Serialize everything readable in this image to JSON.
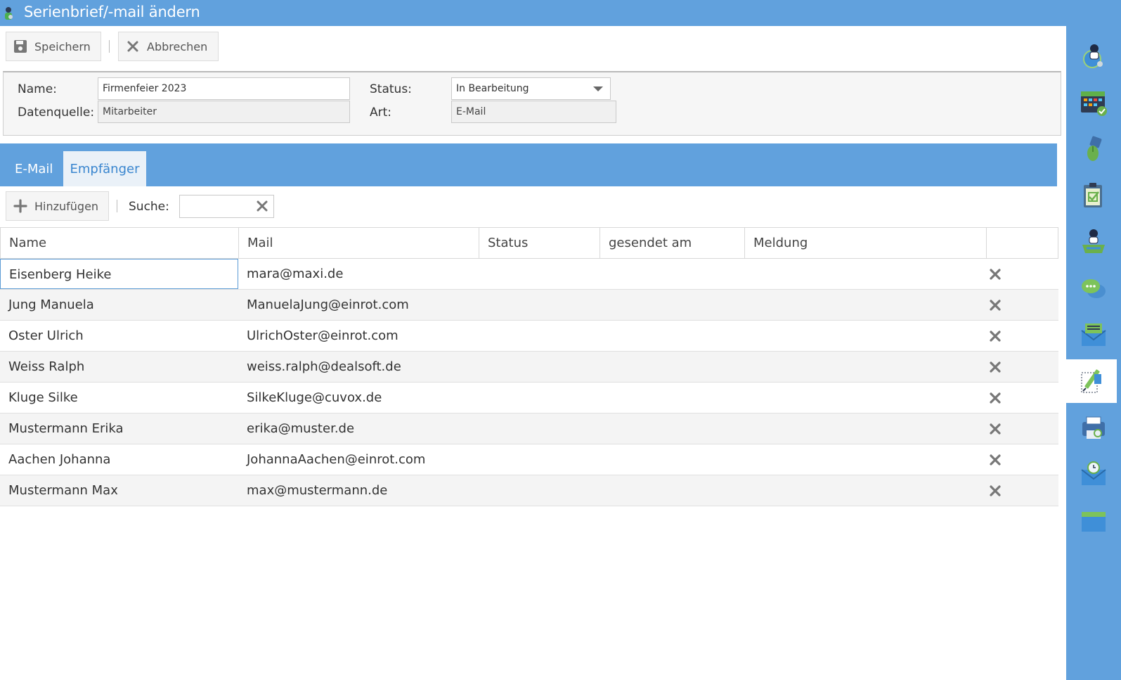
{
  "window": {
    "title": "Serienbrief/-mail ändern"
  },
  "toolbar": {
    "save_label": "Speichern",
    "cancel_label": "Abbrechen"
  },
  "form": {
    "name_label": "Name:",
    "name_value": "Firmenfeier 2023",
    "datasource_label": "Datenquelle:",
    "datasource_value": "Mitarbeiter",
    "status_label": "Status:",
    "status_value": "In Bearbeitung",
    "type_label": "Art:",
    "type_value": "E-Mail"
  },
  "tabs": [
    {
      "label": "E-Mail",
      "active": false
    },
    {
      "label": "Empfänger",
      "active": true
    }
  ],
  "recipients_toolbar": {
    "add_label": "Hinzufügen",
    "search_label": "Suche:",
    "search_value": ""
  },
  "grid": {
    "columns": [
      "Name",
      "Mail",
      "Status",
      "gesendet am",
      "Meldung",
      ""
    ],
    "rows": [
      {
        "name": "Eisenberg Heike",
        "mail": "mara@maxi.de",
        "status": "",
        "sent": "",
        "message": ""
      },
      {
        "name": "Jung Manuela",
        "mail": "ManuelaJung@einrot.com",
        "status": "",
        "sent": "",
        "message": ""
      },
      {
        "name": "Oster Ulrich",
        "mail": "UlrichOster@einrot.com",
        "status": "",
        "sent": "",
        "message": ""
      },
      {
        "name": "Weiss Ralph",
        "mail": "weiss.ralph@dealsoft.de",
        "status": "",
        "sent": "",
        "message": ""
      },
      {
        "name": "Kluge Silke",
        "mail": "SilkeKluge@cuvox.de",
        "status": "",
        "sent": "",
        "message": ""
      },
      {
        "name": "Mustermann Erika",
        "mail": "erika@muster.de",
        "status": "",
        "sent": "",
        "message": ""
      },
      {
        "name": "Aachen Johanna",
        "mail": "JohannaAachen@einrot.com",
        "status": "",
        "sent": "",
        "message": ""
      },
      {
        "name": "Mustermann Max",
        "mail": "max@mustermann.de",
        "status": "",
        "sent": "",
        "message": ""
      }
    ]
  },
  "sidebar": {
    "items": [
      {
        "icon": "contacts-globe-icon",
        "active": false
      },
      {
        "icon": "calendar-icon",
        "active": false
      },
      {
        "icon": "mouse-icon",
        "active": false
      },
      {
        "icon": "clipboard-check-icon",
        "active": false
      },
      {
        "icon": "person-basket-icon",
        "active": false
      },
      {
        "icon": "chat-bubbles-icon",
        "active": false
      },
      {
        "icon": "mail-list-icon",
        "active": false
      },
      {
        "icon": "edit-document-icon",
        "active": true
      },
      {
        "icon": "printer-clock-icon",
        "active": false
      },
      {
        "icon": "mail-clock-icon",
        "active": false
      },
      {
        "icon": "folder-icon",
        "active": false
      }
    ]
  },
  "colors": {
    "accent": "#61a1dd",
    "active_tab_text": "#3a86cf",
    "delete_icon": "#777777"
  }
}
